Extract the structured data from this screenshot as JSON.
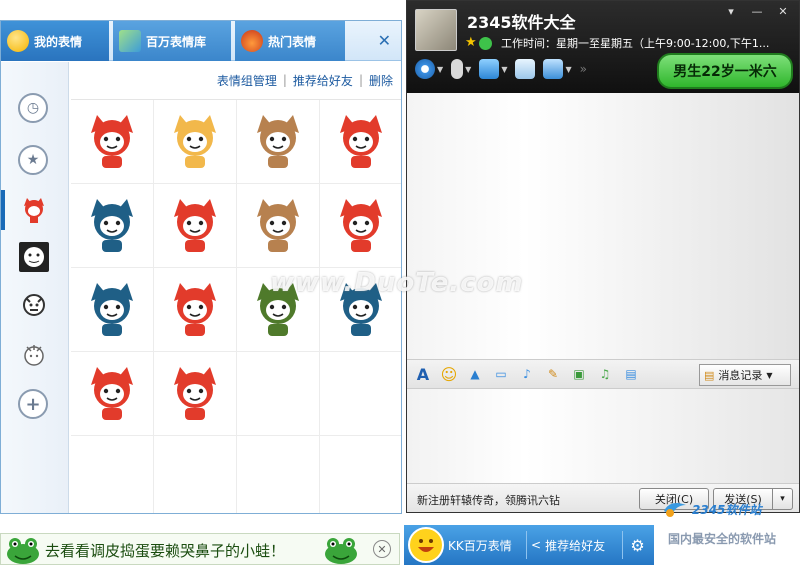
{
  "emoticon_panel": {
    "tabs": [
      {
        "label": "我的表情",
        "icon": "smiley-icon"
      },
      {
        "label": "百万表情库",
        "icon": "cube-icon"
      },
      {
        "label": "热门表情",
        "icon": "fire-icon"
      }
    ],
    "close_glyph": "✕",
    "links": {
      "organize": "表情组管理",
      "recommend": "推荐给好友",
      "delete": "删除",
      "separator": "|"
    },
    "sidebar": [
      {
        "icon": "clock-icon",
        "glyph": "◷"
      },
      {
        "icon": "star-icon",
        "glyph": "★"
      },
      {
        "icon": "fox-thumb-icon"
      },
      {
        "icon": "face-thumb-icon"
      },
      {
        "icon": "sketch-thumb-icon"
      },
      {
        "icon": "doodle-thumb-icon"
      },
      {
        "icon": "add-group-icon",
        "glyph": "+"
      }
    ],
    "stickers": [
      {
        "name": "fox-megaphone-sticker",
        "color": "#e23b2b"
      },
      {
        "name": "fox-crying-moon-sticker",
        "color": "#f2b84b"
      },
      {
        "name": "bear-scooter-sticker",
        "color": "#b7814f"
      },
      {
        "name": "fox-angry-sticker",
        "color": "#e23b2b"
      },
      {
        "name": "blue-cat-waving-sticker",
        "color": "#1f5f86"
      },
      {
        "name": "fox-standing-sticker",
        "color": "#e23b2b"
      },
      {
        "name": "bear-eating-sticker",
        "color": "#b7814f"
      },
      {
        "name": "fox-ice-bath-sticker",
        "color": "#e23b2b"
      },
      {
        "name": "blue-cat-back-sticker",
        "color": "#1f5f86"
      },
      {
        "name": "fox-blue-hat-sticker",
        "color": "#e23b2b"
      },
      {
        "name": "fox-army-helmet-sticker",
        "color": "#4f7a2b"
      },
      {
        "name": "blue-cat-sleeping-sticker",
        "color": "#1f5f86"
      },
      {
        "name": "fox-laughing-sticker",
        "color": "#e23b2b"
      },
      {
        "name": "fox-chef-sticker",
        "color": "#e23b2b"
      }
    ]
  },
  "chat_window": {
    "title": "2345软件大全",
    "work_time": "工作时间：星期一至星期五（上午9:00-12:00,下午1...",
    "window_controls": [
      "▾",
      "—",
      "✕"
    ],
    "age_badge": "男生22岁一米六",
    "toolbar": [
      "video-call-icon",
      "voice-call-icon",
      "file-transfer-icon",
      "sms-icon",
      "remote-assist-icon"
    ],
    "toolbar_overflow": "»",
    "format_bar": [
      {
        "icon": "font-icon",
        "glyph": "A"
      },
      {
        "icon": "emoticon-icon",
        "glyph": "☺"
      },
      {
        "icon": "nudge-icon",
        "glyph": "▲"
      },
      {
        "icon": "screenshot-icon",
        "glyph": "▭"
      },
      {
        "icon": "voice-message-icon",
        "glyph": "♪"
      },
      {
        "icon": "doodle-icon",
        "glyph": "✎"
      },
      {
        "icon": "picture-icon",
        "glyph": "▣"
      },
      {
        "icon": "music-icon",
        "glyph": "♫"
      },
      {
        "icon": "more-icon",
        "glyph": "▤"
      }
    ],
    "history_label": "消息记录",
    "promo": "新注册轩辕传奇，领腾讯六钻",
    "close_label": "关闭(C)",
    "send_label": "发送(S)",
    "send_menu_glyph": "▾"
  },
  "frog_banner": {
    "text": "去看看调皮捣蛋要赖哭鼻子的小蛙！",
    "close_glyph": "✕"
  },
  "kk_bar": {
    "label": "KK百万表情",
    "share": "推荐给好友",
    "gear_glyph": "⚙"
  },
  "site": {
    "name": "2345软件站",
    "slogan": "国内最安全的软件站"
  },
  "watermark": "www.DuoTe.com"
}
